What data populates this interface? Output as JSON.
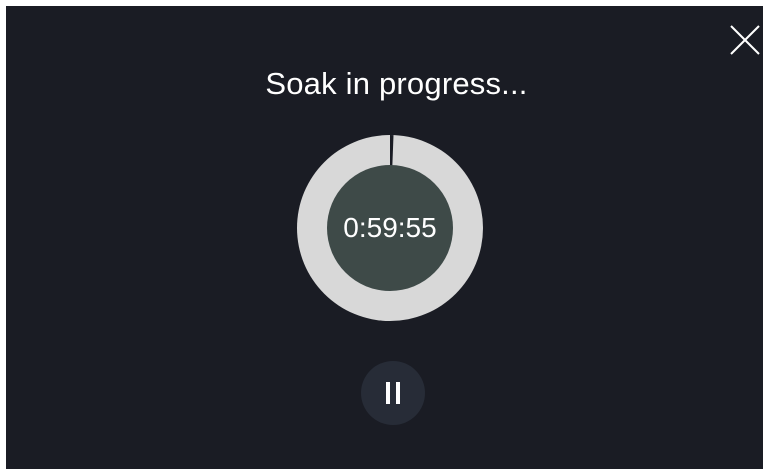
{
  "dialog": {
    "title": "Soak in progress...",
    "close_icon": "close-icon"
  },
  "timer": {
    "remaining": "0:59:55",
    "progress_fraction": 0.0014,
    "ring_color": "#d8d8d8",
    "center_color": "#3e4a48",
    "marker_color": "#1a1c24"
  },
  "controls": {
    "pause_icon": "pause-icon"
  },
  "colors": {
    "background": "#1a1c24",
    "text": "#ffffff",
    "button_bg": "#272c37"
  }
}
